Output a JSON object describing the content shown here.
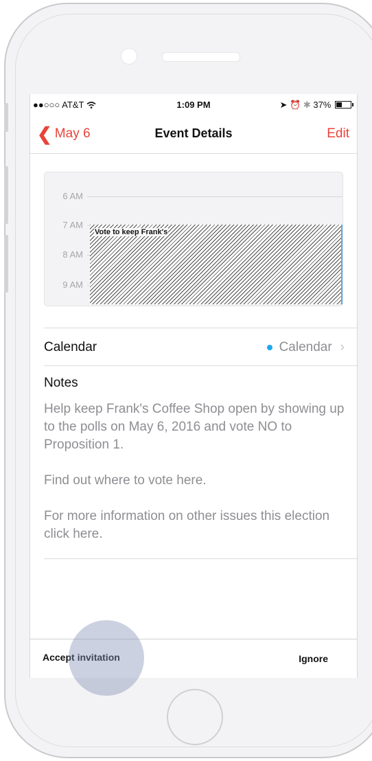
{
  "status_bar": {
    "carrier": "●●○○○ AT&T",
    "time": "1:09 PM",
    "battery": "37%"
  },
  "nav": {
    "back_label": "May 6",
    "title": "Event Details",
    "edit_label": "Edit"
  },
  "day_view": {
    "hours": [
      "6 AM",
      "7 AM",
      "8 AM",
      "9 AM"
    ],
    "event_title": "Vote to keep Frank's",
    "event_color": "#5ab0dc"
  },
  "calendar_row": {
    "label": "Calendar",
    "value": "Calendar",
    "dot_color": "#1ea8ef"
  },
  "notes": {
    "title": "Notes",
    "body": "Help keep Frank's Coffee Shop open by showing up to the polls on May 6, 2016 and vote NO to Proposition 1.\n\nFind out where to vote here.\n\nFor more information on other issues this election click here."
  },
  "footer": {
    "accept_label": "Accept invitation",
    "ignore_label": "Ignore"
  },
  "colors": {
    "accent": "#e8433a"
  }
}
